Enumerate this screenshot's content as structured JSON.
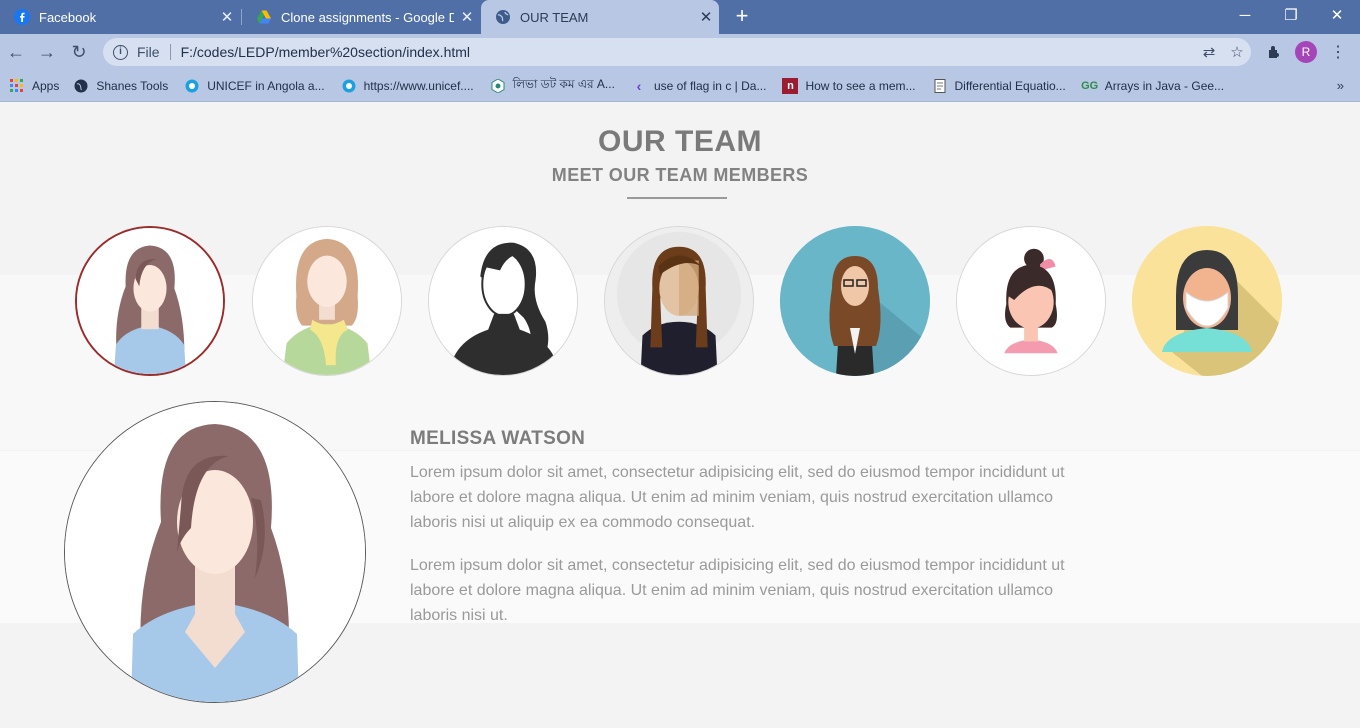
{
  "browser": {
    "tabs": [
      {
        "title": "Facebook",
        "icon": "facebook-icon",
        "active": false
      },
      {
        "title": "Clone assignments - Google Driv",
        "icon": "google-drive-icon",
        "active": false
      },
      {
        "title": "OUR TEAM",
        "icon": "globe-icon",
        "active": true
      }
    ],
    "address": {
      "scheme_label": "File",
      "url": "F:/codes/LEDP/member%20section/index.html"
    },
    "profile_initial": "R",
    "bookmarks": [
      {
        "label": "Apps",
        "icon": "apps-grid-icon"
      },
      {
        "label": "Shanes Tools",
        "icon": "globe-icon"
      },
      {
        "label": "UNICEF in Angola a...",
        "icon": "unicef-icon"
      },
      {
        "label": "https://www.unicef....",
        "icon": "unicef-icon"
      },
      {
        "label": "লিভা ডট কম এর A...",
        "icon": "hex-logo-icon"
      },
      {
        "label": "use of flag in c | Da...",
        "icon": "chevron-left-icon"
      },
      {
        "label": "How to see a mem...",
        "icon": "n-logo-icon"
      },
      {
        "label": "Differential Equatio...",
        "icon": "pdf-page-icon"
      },
      {
        "label": "Arrays in Java - Gee...",
        "icon": "gfg-icon"
      }
    ]
  },
  "page": {
    "title": "OUR TEAM",
    "subtitle": "MEET OUR TEAM MEMBERS",
    "members": [
      {
        "avatar": "long-brown-hair-avatar",
        "active": true
      },
      {
        "avatar": "scarf-blonde-avatar",
        "active": false
      },
      {
        "avatar": "silhouette-avatar",
        "active": false
      },
      {
        "avatar": "braids-avatar",
        "active": false
      },
      {
        "avatar": "glasses-business-avatar",
        "active": false
      },
      {
        "avatar": "hair-bun-avatar",
        "active": false
      },
      {
        "avatar": "face-mask-avatar",
        "active": false
      }
    ],
    "selected": {
      "name": "MELISSA WATSON",
      "bio_1": "Lorem ipsum dolor sit amet, consectetur adipisicing elit, sed do eiusmod tempor incididunt ut labore et dolore magna aliqua. Ut enim ad minim veniam, quis nostrud exercitation ullamco laboris nisi ut aliquip ex ea commodo consequat.",
      "bio_2": "Lorem ipsum dolor sit amet, consectetur adipisicing elit, sed do eiusmod tempor incididunt ut labore et dolore magna aliqua. Ut enim ad minim veniam, quis nostrud exercitation ullamco laboris nisi ut."
    }
  },
  "colors": {
    "tabstrip": "#4f6fa6",
    "toolbar": "#b7c7e4",
    "active_ring": "#9b2c2c",
    "heading": "#7a7a7a",
    "body_text": "#9a9a9a"
  }
}
